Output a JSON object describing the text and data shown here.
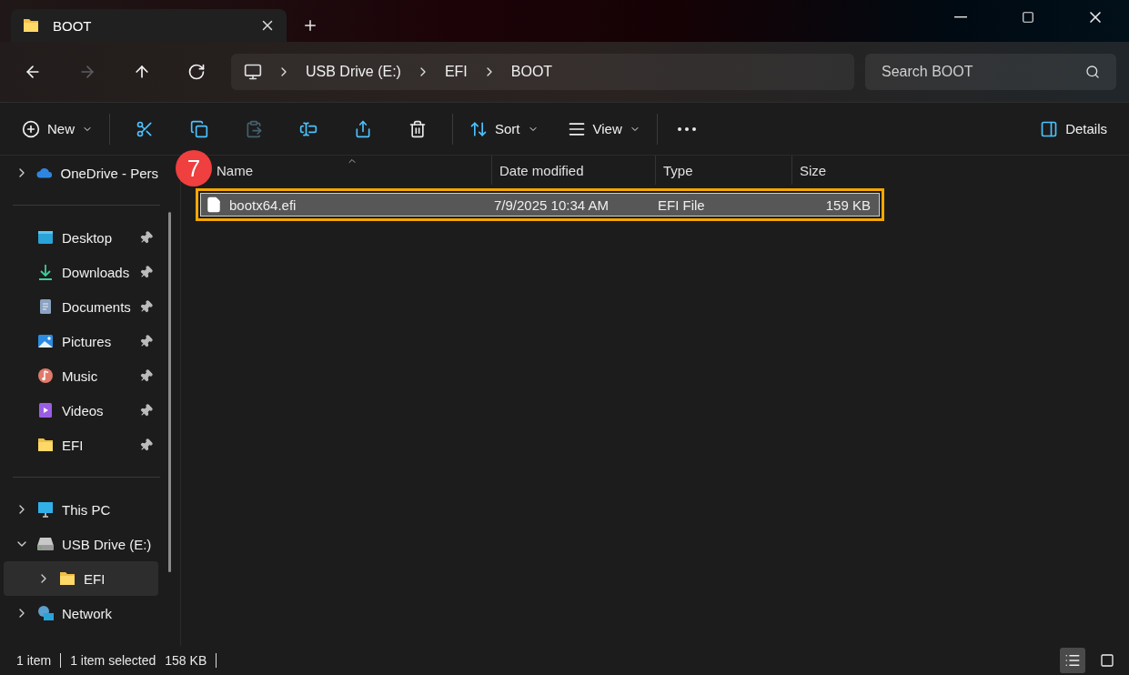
{
  "tabs": [
    {
      "label": "BOOT",
      "selected": true
    }
  ],
  "breadcrumb": [
    "USB Drive (E:)",
    "EFI",
    "BOOT"
  ],
  "search": {
    "placeholder": "Search BOOT"
  },
  "nav_buttons": [
    {
      "disabled": false
    },
    {
      "disabled": true
    },
    {
      "disabled": false
    },
    {
      "disabled": false
    }
  ],
  "toolbar": {
    "new": "New",
    "icon_actions": [
      {
        "disabled": false
      },
      {
        "disabled": false
      },
      {
        "disabled": true
      },
      {
        "disabled": false
      },
      {
        "disabled": false
      },
      {
        "disabled": false
      }
    ],
    "sort": "Sort",
    "view": "View",
    "details": "Details"
  },
  "nav": {
    "groups": [
      [
        {
          "label": "OneDrive - Pers",
          "expanded": false
        }
      ],
      [
        {
          "label": "Desktop",
          "pinned": true
        },
        {
          "label": "Downloads",
          "pinned": true
        },
        {
          "label": "Documents",
          "pinned": true
        },
        {
          "label": "Pictures",
          "pinned": true
        },
        {
          "label": "Music",
          "pinned": true
        },
        {
          "label": "Videos",
          "pinned": true
        },
        {
          "label": "EFI",
          "pinned": true
        }
      ],
      [
        {
          "label": "This PC",
          "expanded": false
        },
        {
          "label": "USB Drive (E:)",
          "expanded": true,
          "children": [
            {
              "label": "EFI",
              "expanded": false,
              "selected": true
            }
          ]
        },
        {
          "label": "Network",
          "expanded": false
        }
      ]
    ]
  },
  "table": {
    "columns": [
      "Name",
      "Date modified",
      "Type",
      "Size"
    ],
    "rows": [
      {
        "name": "bootx64.efi",
        "date": "7/9/2025 10:34 AM",
        "type": "EFI File",
        "size": "159 KB",
        "selected": true,
        "highlighted": true
      }
    ]
  },
  "annotation_badge": "7",
  "status_bar": {
    "count": "1 item",
    "selection": "1 item selected",
    "size": "158 KB",
    "view_buttons": [
      {
        "selected": true
      },
      {
        "selected": false
      }
    ]
  }
}
